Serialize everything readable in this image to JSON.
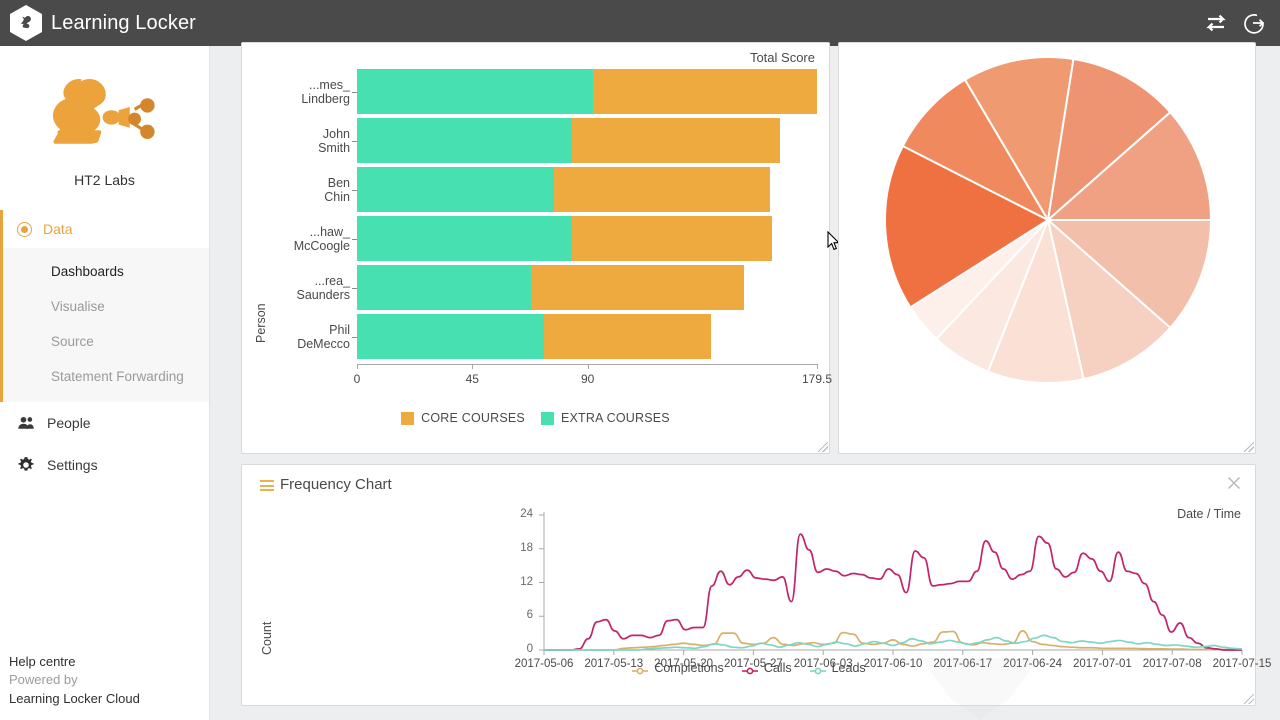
{
  "topbar": {
    "brand": "Learning Locker",
    "logo_icon": "squirrel-hex-logo-icon",
    "actions": [
      {
        "name": "swap-arrows-icon",
        "label": "Switch organisation"
      },
      {
        "name": "logout-icon",
        "label": "Log out"
      }
    ]
  },
  "sidebar": {
    "org_logo_icon": "ht2-squirrel-logo-icon",
    "org_name": "HT2 Labs",
    "nav": {
      "primary": {
        "label": "Data",
        "icon": "radio-selected-icon",
        "active": true
      },
      "sub_items": [
        {
          "label": "Dashboards",
          "active": true
        },
        {
          "label": "Visualise",
          "active": false
        },
        {
          "label": "Source",
          "active": false
        },
        {
          "label": "Statement Forwarding",
          "active": false
        }
      ],
      "items": [
        {
          "label": "People",
          "icon": "people-icon"
        },
        {
          "label": "Settings",
          "icon": "gear-icon"
        }
      ]
    },
    "footer": {
      "help": "Help centre",
      "powered_by": "Powered by",
      "product": "Learning Locker Cloud"
    }
  },
  "chart_data": [
    {
      "type": "bar",
      "orientation": "horizontal",
      "stacked": true,
      "title": "Total Score",
      "xlabel": "",
      "ylabel": "Person",
      "categories": [
        "...mes_\nLindberg",
        "John Smith",
        "Ben Chin",
        "...haw_\nMcCoogle",
        "...rea_\nSaunders",
        "Phil DeMecco"
      ],
      "xticks": [
        "0",
        "45",
        "90",
        "179.5"
      ],
      "xtick_values": [
        0,
        45,
        90,
        179.5
      ],
      "xlim": [
        0,
        179.5
      ],
      "series": [
        {
          "name": "EXTRA COURSES",
          "color": "#47e0b0",
          "values": [
            92,
            84,
            77,
            84,
            68,
            73
          ]
        },
        {
          "name": "CORE COURSES",
          "color": "#eeaa3e",
          "values": [
            87.5,
            81,
            84,
            78,
            83,
            65
          ]
        }
      ],
      "legend": [
        {
          "label": "CORE COURSES",
          "color": "#eeaa3e"
        },
        {
          "label": "EXTRA COURSES",
          "color": "#47e0b0"
        }
      ],
      "grid": false
    },
    {
      "type": "pie",
      "title": "",
      "slice_count": 10,
      "values": [
        11.5,
        10.0,
        9.5,
        6.0,
        4.0,
        16.5,
        9.0,
        11.0,
        11.0,
        11.5
      ],
      "colors": [
        "#f2c0aa",
        "#f6d0c0",
        "#fae0d5",
        "#fbe8e0",
        "#fdf0ea",
        "#ef7041",
        "#f08a5e",
        "#f09a72",
        "#ef9472",
        "#f0a183"
      ],
      "legend": []
    },
    {
      "type": "line",
      "title": "Frequency Chart",
      "xlabel": "Date / Time",
      "ylabel": "Count",
      "yticks": [
        "0",
        "6",
        "12",
        "18",
        "24"
      ],
      "ytick_values": [
        0,
        6,
        12,
        18,
        24
      ],
      "ylim": [
        0,
        24
      ],
      "xticks": [
        "2017-05-06",
        "2017-05-13",
        "2017-05-20",
        "2017-05-27",
        "2017-06-03",
        "2017-06-10",
        "2017-06-17",
        "2017-06-24",
        "2017-07-01",
        "2017-07-08",
        "2017-07-15"
      ],
      "grid": false,
      "legend_position": "bottom",
      "series": [
        {
          "name": "Completions",
          "color": "#d9b06a",
          "values": [
            0,
            0,
            0,
            0,
            0,
            0,
            0,
            0,
            0.3,
            0.4,
            0.5,
            0.6,
            0.8,
            1,
            1.2,
            1,
            0.8,
            1,
            3,
            3,
            1.2,
            1,
            1.2,
            2.2,
            1,
            0.8,
            1.1,
            1.3,
            1,
            1.2,
            3.1,
            2.8,
            1.2,
            1,
            1.2,
            1.8,
            1,
            0.7,
            1.1,
            1.4,
            3.2,
            3.3,
            1.2,
            0.9,
            1.3,
            1.1,
            1,
            1.2,
            3.4,
            1.5,
            1,
            0.8,
            0.6,
            0.5,
            0.4,
            0.4,
            0.3,
            0.3,
            0.3,
            0.3,
            0.25,
            0.2,
            0.2,
            0.15,
            0.15,
            0.1,
            0.1,
            0.1,
            0.1,
            0.1,
            0.1
          ]
        },
        {
          "name": "Calls",
          "color": "#c2256c",
          "values": [
            0,
            0,
            0,
            0,
            0.2,
            2,
            5,
            5.4,
            3.4,
            2,
            2.6,
            2.6,
            2.2,
            2.6,
            5.2,
            5.4,
            3.6,
            4,
            4,
            11.4,
            14,
            11.6,
            13,
            14.2,
            12.8,
            12.6,
            12.4,
            13,
            8.6,
            20.6,
            17.8,
            13.8,
            14.4,
            14,
            13.2,
            13.6,
            13.4,
            12.8,
            12.6,
            14.4,
            13.4,
            10.2,
            17.6,
            16.4,
            11.4,
            11.6,
            11.8,
            12.2,
            12.2,
            14,
            19.4,
            17.4,
            14.4,
            12.6,
            13.4,
            14,
            20.2,
            19,
            14.4,
            13,
            13.8,
            17.2,
            16.2,
            14,
            12.2,
            17.4,
            14,
            13.6,
            11.8,
            8.6,
            6.2,
            3.2,
            4.8,
            2.2,
            1.2,
            0.4,
            0.2,
            0,
            0,
            0
          ]
        },
        {
          "name": "Leads",
          "color": "#7fd6c4",
          "values": [
            0,
            0,
            0,
            0,
            0,
            0,
            0,
            0,
            0,
            0,
            0,
            0.2,
            0.3,
            0.4,
            0.5,
            0.4,
            0.3,
            0.6,
            1.1,
            0.9,
            0.5,
            0.4,
            0.7,
            1.2,
            0.9,
            0.5,
            0.9,
            1.3,
            1,
            0.6,
            1,
            1.4,
            1.1,
            0.7,
            1.1,
            1.5,
            1.2,
            0.8,
            1.3,
            2,
            1.6,
            1.1,
            1.4,
            1.7,
            1.4,
            1,
            1.3,
            1.8,
            2.2,
            1.6,
            1.2,
            1.5,
            2.1,
            2.6,
            2.2,
            1.5,
            1.3,
            1.6,
            1.4,
            1.2,
            1.5,
            1.7,
            1.4,
            1.1,
            1.3,
            1,
            0.8,
            0.9,
            0.7,
            0.5,
            0.6,
            0.8,
            0.5,
            0.3,
            0.2
          ]
        }
      ]
    }
  ],
  "frequency_panel": {
    "menu_icon": "hamburger-icon",
    "close_icon": "close-icon"
  },
  "colors": {
    "accent": "#e8a33d",
    "teal": "#47e0b0",
    "orange": "#eeaa3e",
    "topbar_bg": "#4a4a4a",
    "canvas_bg": "#eceef0"
  }
}
